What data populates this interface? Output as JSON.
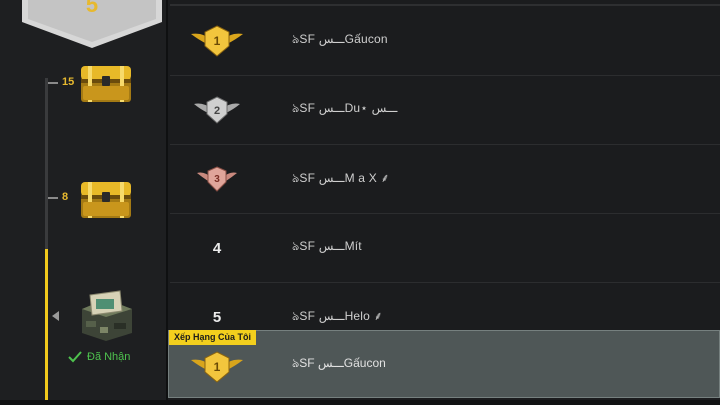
{
  "sidebar": {
    "current_rank": "5",
    "milestones": [
      {
        "threshold": "15",
        "reward": "gold-chest-icon"
      },
      {
        "threshold": "8",
        "reward": "gold-chest-icon"
      },
      {
        "threshold": "",
        "reward": "camo-crate-icon"
      }
    ],
    "progress_fraction": 0.47,
    "claimed_label": "Đã Nhận"
  },
  "leaderboard": {
    "rows": [
      {
        "rank": "1",
        "badge": "gold-rank-1-badge-icon",
        "name": "ঌSF ـــسGấucon"
      },
      {
        "rank": "2",
        "badge": "silver-rank-2-badge-icon",
        "name": "ঌSF ـــسDu⋆ ـــس"
      },
      {
        "rank": "3",
        "badge": "bronze-rank-3-badge-icon",
        "name": "ঌSF ـــسM a X ⸙"
      },
      {
        "rank": "4",
        "badge": "",
        "name": "ঌSF ـــسMít"
      },
      {
        "rank": "5",
        "badge": "",
        "name": "ঌSF ـــسHelo ⸙"
      }
    ],
    "my_rank": {
      "tag": "Xếp Hạng Của Tôi",
      "rank": "1",
      "badge": "gold-rank-1-badge-icon",
      "name": "ঌSF ـــسGấucon"
    }
  },
  "colors": {
    "accent_gold": "#f1c91c",
    "claimed_green": "#4ec24e",
    "highlight_row": "#4f5757"
  }
}
